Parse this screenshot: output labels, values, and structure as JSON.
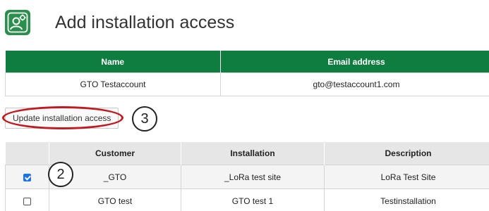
{
  "page": {
    "title": "Add installation access",
    "logo_icon": "user-settings-icon",
    "brand_color": "#0f7d3f"
  },
  "user_table": {
    "headers": [
      "Name",
      "Email address"
    ],
    "rows": [
      {
        "name": "GTO Testaccount",
        "email": "gto@testaccount1.com"
      }
    ]
  },
  "actions": {
    "update_label": "Update installation access"
  },
  "callouts": {
    "update": "3",
    "checkbox": "2"
  },
  "installations": {
    "headers": [
      "",
      "Customer",
      "Installation",
      "Description"
    ],
    "rows": [
      {
        "checked": true,
        "customer": "_GTO",
        "installation": "_LoRa test site",
        "description": "LoRa Test Site"
      },
      {
        "checked": false,
        "customer": "GTO test",
        "installation": "GTO test 1",
        "description": "Testinstallation"
      }
    ]
  }
}
